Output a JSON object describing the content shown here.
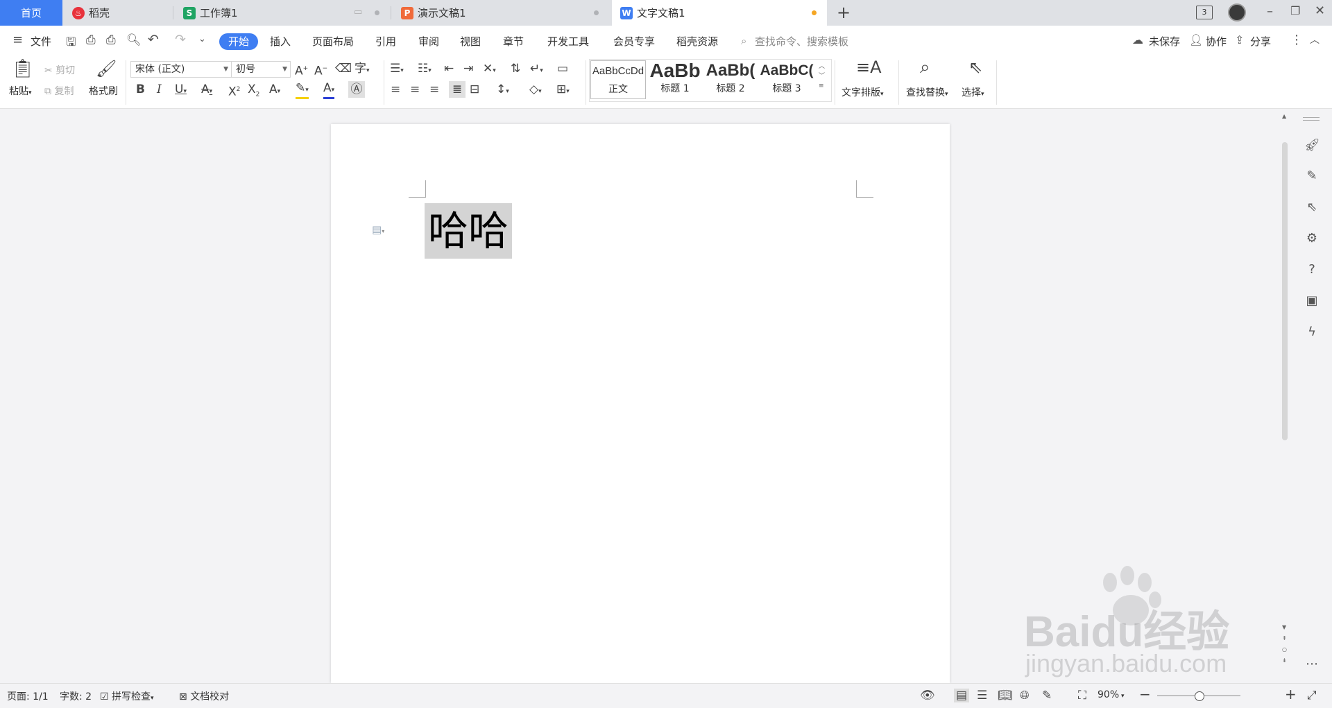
{
  "tabs": [
    {
      "label": "首页",
      "icon": "home"
    },
    {
      "label": "稻壳",
      "icon": "daoke-icon",
      "icon_color": "#e8323c"
    },
    {
      "label": "工作簿1",
      "icon": "spreadsheet-icon",
      "icon_color": "#1fa463",
      "icon_text": "S"
    },
    {
      "label": "演示文稿1",
      "icon": "presentation-icon",
      "icon_color": "#f06a3a",
      "icon_text": "P"
    },
    {
      "label": "文字文稿1",
      "icon": "writer-icon",
      "icon_color": "#3f7ef2",
      "icon_text": "W"
    }
  ],
  "tabbar": {
    "new_tab": "+",
    "window_count": "3",
    "unsaved_dot_color": "#f5a623"
  },
  "menubar": {
    "file": "文件",
    "tabs": [
      "开始",
      "插入",
      "页面布局",
      "引用",
      "审阅",
      "视图",
      "章节",
      "开发工具",
      "会员专享",
      "稻壳资源"
    ],
    "search_placeholder": "查找命令、搜索模板",
    "unsaved": "未保存",
    "collaborate": "协作",
    "share": "分享",
    "accent": "#3f7ef2"
  },
  "ribbon": {
    "paste": "粘贴",
    "cut": "剪切",
    "copy": "复制",
    "format_painter": "格式刷",
    "font_name": "宋体 (正文)",
    "font_size": "初号",
    "styles": [
      {
        "sample": "AaBbCcDd",
        "name": "正文"
      },
      {
        "sample": "AaBb",
        "name": "标题 1"
      },
      {
        "sample": "AaBb(",
        "name": "标题 2"
      },
      {
        "sample": "AaBbC(",
        "name": "标题 3"
      }
    ],
    "text_layout": "文字排版",
    "find_replace": "查找替换",
    "select": "选择"
  },
  "document": {
    "text": "哈哈"
  },
  "statusbar": {
    "page": "页面: 1/1",
    "words": "字数: 2",
    "spellcheck": "拼写检查",
    "proofread": "文档校对",
    "zoom": "90%",
    "zoom_level": 0.5
  },
  "watermark": {
    "brand": "Baidu经验",
    "url": "jingyan.baidu.com"
  }
}
